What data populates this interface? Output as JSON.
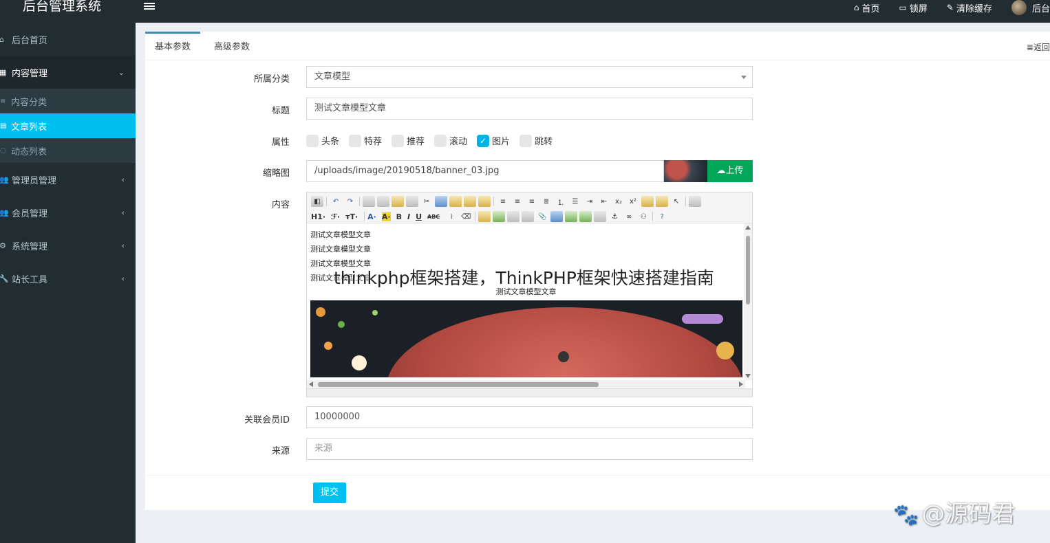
{
  "header": {
    "app_title": "后台管理系统",
    "nav": [
      {
        "icon": "home-icon",
        "label": "首页"
      },
      {
        "icon": "monitor-icon",
        "label": "锁屏"
      },
      {
        "icon": "brush-icon",
        "label": "清除缓存"
      },
      {
        "icon": "avatar",
        "label": "后台"
      }
    ]
  },
  "sidebar": {
    "items": [
      {
        "icon": "home-icon",
        "label": "后台首页"
      },
      {
        "icon": "grid-icon",
        "label": "内容管理",
        "expanded": true,
        "children": [
          {
            "icon": "list-icon",
            "label": "内容分类"
          },
          {
            "icon": "file-icon",
            "label": "文章列表",
            "current": true
          },
          {
            "icon": "circle-icon",
            "label": "动态列表"
          }
        ]
      },
      {
        "icon": "users-icon",
        "label": "管理员管理"
      },
      {
        "icon": "users-icon",
        "label": "会员管理"
      },
      {
        "icon": "gear-icon",
        "label": "系统管理"
      },
      {
        "icon": "wrench-icon",
        "label": "站长工具"
      }
    ]
  },
  "tabs": {
    "basic": "基本参数",
    "advanced": "高级参数",
    "back": "返回"
  },
  "form": {
    "category": {
      "label": "所属分类",
      "value": "文章模型"
    },
    "title": {
      "label": "标题",
      "value": "测试文章模型文章"
    },
    "attributes": {
      "label": "属性",
      "options": [
        {
          "label": "头条",
          "checked": false
        },
        {
          "label": "特荐",
          "checked": false
        },
        {
          "label": "推荐",
          "checked": false
        },
        {
          "label": "滚动",
          "checked": false
        },
        {
          "label": "图片",
          "checked": true
        },
        {
          "label": "跳转",
          "checked": false
        }
      ]
    },
    "thumbnail": {
      "label": "缩略图",
      "value": "/uploads/image/20190518/banner_03.jpg",
      "upload_label": "上传"
    },
    "content": {
      "label": "内容",
      "toolbar_text": {
        "h1": "H1·",
        "font": "ℱ·",
        "size": "тT·",
        "fontcolor": "A·",
        "bgcolor": "A·",
        "bold": "B",
        "italic": "I",
        "underline": "U",
        "strike": "ABC"
      },
      "lines": [
        "测试文章模型文章",
        "测试文章模型文章",
        "测试文章模型文章",
        "测试文章模型文章"
      ],
      "centered_line": "测试文章模型文章"
    },
    "member_id": {
      "label": "关联会员ID",
      "value": "10000000"
    },
    "source": {
      "label": "来源",
      "placeholder": "来源"
    },
    "submit_label": "提交"
  },
  "overlay_title": "thinkphp框架搭建，ThinkPHP框架快速搭建指南",
  "watermark": "@源码君",
  "colors": {
    "sidebar_bg": "#222d32",
    "active_blue": "#00c0ef",
    "upload_green": "#00a65a",
    "tab_accent": "#3c8dbc"
  }
}
